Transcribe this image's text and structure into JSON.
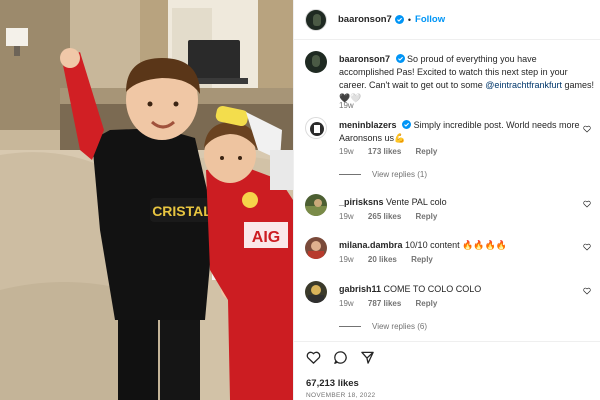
{
  "post": {
    "author": "baaronson7",
    "follow_label": "Follow",
    "separator": "•",
    "caption_author": "baaronson7",
    "caption_part1": "So proud of everything you have accomplished Pas! Excited to watch this next step in your career. Can't wait to get out to some ",
    "caption_mention": "@eintrachtfrankfurt",
    "caption_part2": " games!",
    "caption_emoji": "🖤🤍",
    "caption_time": "19w",
    "likes": "67,213 likes",
    "date": "NOVEMBER 18, 2022"
  },
  "comments": [
    {
      "user": "meninblazers",
      "verified": true,
      "text": "Simply incredible post. World needs more Aaronsons us💪",
      "time": "19w",
      "likes": "173 likes",
      "reply_label": "Reply",
      "view_replies": "View replies (1)"
    },
    {
      "user": "_pirisksns",
      "verified": false,
      "text": "Vente PAL colo",
      "time": "19w",
      "likes": "265 likes",
      "reply_label": "Reply",
      "view_replies": ""
    },
    {
      "user": "milana.dambra",
      "verified": false,
      "text": "10/10 content 🔥🔥🔥🔥",
      "time": "19w",
      "likes": "20 likes",
      "reply_label": "Reply",
      "view_replies": ""
    },
    {
      "user": "gabrish11",
      "verified": false,
      "text": "COME TO COLO COLO",
      "time": "19w",
      "likes": "787 likes",
      "reply_label": "Reply",
      "view_replies": "View replies (6)"
    }
  ],
  "photo": {
    "jersey_left_text": "CRISTAL",
    "jersey_right_text": "AIG"
  },
  "colors": {
    "accent": "#0095f6",
    "verified": "#0095f6",
    "mention": "#00376b",
    "muted": "#737373"
  },
  "icons": [
    "verified-icon",
    "heart-icon",
    "comment-icon",
    "share-icon"
  ]
}
